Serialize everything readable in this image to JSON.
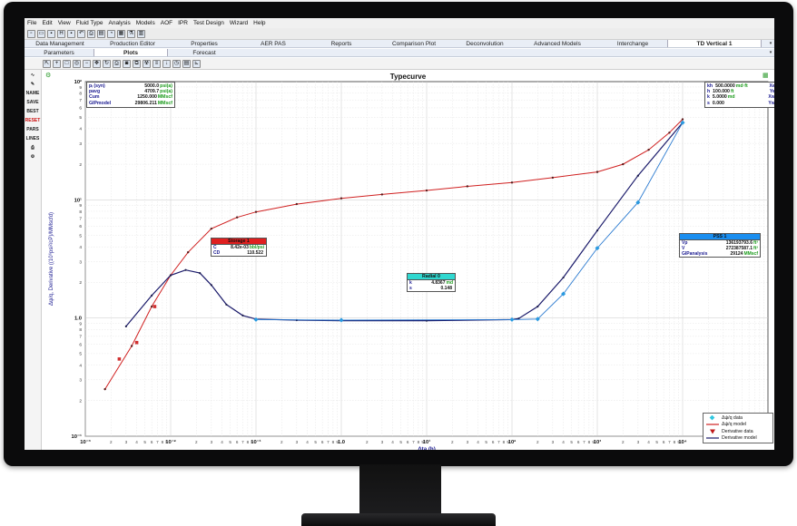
{
  "app": {
    "menu": [
      "File",
      "Edit",
      "View",
      "Fluid Type",
      "Analysis",
      "Models",
      "AOF",
      "IPR",
      "Test Design",
      "Wizard",
      "Help"
    ],
    "toolbar_icons": [
      "new-file-icon",
      "open-folder-icon",
      "save-icon",
      "save-green-icon",
      "save-as-icon",
      "undo-icon",
      "print-icon",
      "report-icon",
      "chart-icon",
      "calculator-icon",
      "flask-icon",
      "bars-icon"
    ]
  },
  "tabs_top": {
    "items": [
      "Data Management",
      "Production Editor",
      "Properties",
      "AER PAS",
      "Reports",
      "Comparison Plot",
      "Deconvolution",
      "Advanced Models",
      "Interchange",
      "TD Vertical 1"
    ],
    "active": "TD Vertical 1"
  },
  "tabs_sub": {
    "items": [
      "Parameters",
      "Plots",
      "Forecast"
    ],
    "active": "Plots"
  },
  "plot_toolbar_icons": [
    "select-icon",
    "zoom-in-icon",
    "rectangle-icon",
    "zoom-icon",
    "zoom-out-icon",
    "pan-icon",
    "refresh-icon",
    "print-icon",
    "camera-icon",
    "copy-icon",
    "radiation-icon",
    "lines-icon",
    "down-arrow-icon",
    "clock-icon",
    "table-icon",
    "axis-icon"
  ],
  "sidebar": {
    "items": [
      "curve-icon",
      "pen-icon",
      "NAME",
      "SAVE",
      "BEST",
      "RESET",
      "PARS",
      "LINES",
      "print-icon",
      "settings-icon"
    ],
    "red_item": "RESET"
  },
  "plot": {
    "title": "Typecurve",
    "xlabel": "Δta (h)",
    "ylabel": "Δψ/q, Derivative ((10⁶psi²/cP)/MMscfd)"
  },
  "params_left": [
    {
      "label": "pᵢ (syn)",
      "value": "5000.0",
      "unit": "psi(a)"
    },
    {
      "label": "pavg",
      "value": "4709.7",
      "unit": "psi(a)"
    },
    {
      "label": "Cum",
      "value": "1250.000",
      "unit": "MMscf"
    },
    {
      "label": "GIPmodel",
      "value": "29806.211",
      "unit": "MMscf"
    }
  ],
  "params_right": [
    {
      "label": "kh",
      "value": "500.0000",
      "unit": "md·ft",
      "label2": "Xe",
      "value2": "5280.000",
      "unit2": "ft"
    },
    {
      "label": "h",
      "value": "100.000",
      "unit": "ft",
      "label2": "Ye",
      "value2": "5280.000",
      "unit2": "ft"
    },
    {
      "label": "k",
      "value": "5.0000",
      "unit": "md",
      "label2": "Xw",
      "value2": "2640.000",
      "unit2": "ft"
    },
    {
      "label": "s",
      "value": "0.000",
      "unit": "",
      "label2": "Yw",
      "value2": "2640.000",
      "unit2": "ft"
    }
  ],
  "annotations": {
    "storage": {
      "title": "Storage 1",
      "rows": [
        {
          "label": "C",
          "value": "8.42e-03",
          "unit": "bbl/psi"
        },
        {
          "label": "CD",
          "value": "110.522",
          "unit": ""
        }
      ],
      "color": "#e02020"
    },
    "radial": {
      "title": "Radial 0",
      "rows": [
        {
          "label": "k",
          "value": "4.8367",
          "unit": "md"
        },
        {
          "label": "s",
          "value": "0.148",
          "unit": ""
        }
      ],
      "color": "#30d8d0"
    },
    "pss": {
      "title": "PSS 1",
      "rows": [
        {
          "label": "Vp",
          "value": "136193793.6",
          "unit": "ft³"
        },
        {
          "label": "V",
          "value": "272387587.1",
          "unit": "ft³"
        },
        {
          "label": "GIPanalysis",
          "value": "29124",
          "unit": "MMscf"
        }
      ],
      "color": "#1a8ef0"
    }
  },
  "legend": [
    {
      "label": "Δψ/q data",
      "symbol": "cyan-diamond"
    },
    {
      "label": "Δψ/q model",
      "symbol": "red-line"
    },
    {
      "label": "Derivative data",
      "symbol": "red-triangle"
    },
    {
      "label": "Derivative model",
      "symbol": "navy-line"
    }
  ],
  "colors": {
    "pressure_model": "#d02020",
    "derivative_model": "#1a1a6a",
    "pressure_data": "#2a9ae0",
    "derivative_data": "#8a1a1a",
    "pss_model": "#2a7ad0"
  },
  "chart_data": {
    "type": "line",
    "title": "Typecurve",
    "xlabel": "Δta (h)",
    "ylabel": "Δψ/q, Derivative ((10⁶psi²/cP)/MMscfd)",
    "xscale": "log",
    "yscale": "log",
    "xlim": [
      0.001,
      100000
    ],
    "ylim": [
      0.1,
      100
    ],
    "x_tick_labels": [
      "10⁻³",
      "10⁻²",
      "10⁻¹",
      "1.0",
      "10¹",
      "10²",
      "10³",
      "10⁴"
    ],
    "y_tick_labels": [
      "10⁻¹",
      "1.0",
      "10¹",
      "10²"
    ],
    "grid": true,
    "legend_position": "bottom-right",
    "series": [
      {
        "name": "Δψ/q model",
        "x": [
          0.0017,
          0.0035,
          0.006,
          0.01,
          0.016,
          0.03,
          0.06,
          0.1,
          0.3,
          1,
          3,
          10,
          30,
          100,
          300,
          1000,
          2000,
          4000,
          7000,
          10000
        ],
        "y": [
          0.25,
          0.58,
          1.25,
          2.3,
          3.6,
          5.7,
          7.1,
          7.9,
          9.2,
          10.3,
          11.1,
          12.0,
          13.0,
          14.0,
          15.4,
          17.2,
          20.0,
          26.5,
          37,
          48
        ]
      },
      {
        "name": "Derivative model",
        "x": [
          0.003,
          0.006,
          0.01,
          0.015,
          0.022,
          0.03,
          0.045,
          0.07,
          0.1,
          0.3,
          1,
          10,
          100,
          120,
          200,
          400,
          1000,
          3000,
          10000
        ],
        "y": [
          0.85,
          1.55,
          2.3,
          2.55,
          2.4,
          1.9,
          1.3,
          1.05,
          0.98,
          0.96,
          0.95,
          0.95,
          0.97,
          0.99,
          1.25,
          2.2,
          5.5,
          16,
          45
        ]
      },
      {
        "name": "Δψ/q data",
        "x": [
          0.1,
          1,
          100,
          200,
          400,
          1000,
          3000,
          10000
        ],
        "y": [
          0.97,
          0.96,
          0.97,
          0.98,
          1.6,
          3.9,
          9.5,
          45
        ]
      },
      {
        "name": "Derivative data",
        "x": [
          0.0025,
          0.004,
          0.0065
        ],
        "y": [
          0.45,
          0.62,
          1.25
        ]
      }
    ]
  }
}
